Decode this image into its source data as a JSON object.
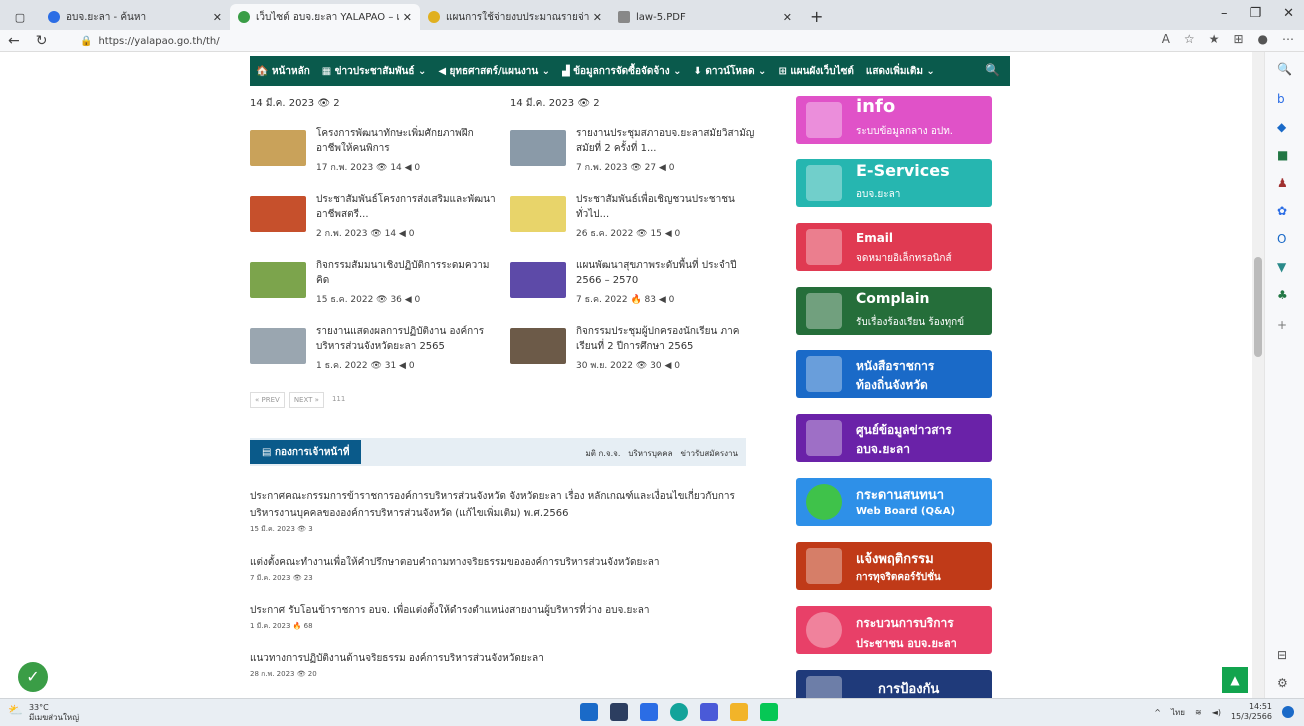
{
  "browser": {
    "tabs": [
      {
        "label": "อบจ.ยะลา - ค้นหา",
        "color": "#2b6de5"
      },
      {
        "label": "เว็บไซต์ อบจ.ยะลา YALAPAO – เว็บไ",
        "color": "#3a9d46"
      },
      {
        "label": "แผนการใช้จ่ายงบประมาณรายจ่ายประจ",
        "color": "#e0b020"
      },
      {
        "label": "law-5.PDF",
        "color": "#888888"
      }
    ],
    "new_tab": "+",
    "url": "https://yalapao.go.th/th/"
  },
  "menu": {
    "items": [
      "หน้าหลัก",
      "ข่าวประชาสัมพันธ์ ⌄",
      "ยุทธศาสตร์/แผนงาน ⌄",
      "ข้อมูลการจัดซื้อจัดจ้าง ⌄",
      "ดาวน์โหลด ⌄",
      "แผนผังเว็บไซต์",
      "แสดงเพิ่มเติม ⌄"
    ],
    "search_icon": "search-icon",
    "icon_glyphs": [
      "🏠",
      "▦",
      "◀",
      "▟",
      "⬇",
      "⊞",
      ""
    ]
  },
  "dates_top": [
    "14 มี.ค. 2023  👁 2",
    "14 มี.ค. 2023  👁 2"
  ],
  "posts": [
    {
      "title": "โครงการพัฒนาทักษะเพิ่มศักยภาพฝึกอาชีพให้คนพิการ",
      "meta": "17 ก.พ. 2023   👁 14   ◀ 0",
      "color": "#c9a25a"
    },
    {
      "title": "รายงานประชุมสภาอบจ.ยะลาสมัยวิสามัญ สมัยที่ 2 ครั้งที่ 1...",
      "meta": "7 ก.พ. 2023   👁 27   ◀ 0",
      "color": "#8a9aa8"
    },
    {
      "title": "ประชาสัมพันธ์โครงการส่งเสริมและพัฒนาอาชีพสตรี...",
      "meta": "2 ก.พ. 2023   👁 14   ◀ 0",
      "color": "#c6502c"
    },
    {
      "title": "ประชาสัมพันธ์เพื่อเชิญชวนประชาชนทั่วไป...",
      "meta": "26 ธ.ค. 2022   👁 15   ◀ 0",
      "color": "#e8d46a"
    },
    {
      "title": "กิจกรรมสัมมนาเชิงปฏิบัติการระดมความคิด",
      "meta": "15 ธ.ค. 2022   👁 36   ◀ 0",
      "color": "#7ca44c"
    },
    {
      "title": "แผนพัฒนาสุขภาพระดับพื้นที่ ประจำปี 2566 – 2570",
      "meta": "7 ธ.ค. 2022   🔥 83   ◀ 0",
      "color": "#5d4aa8"
    },
    {
      "title": "รายงานแสดงผลการปฏิบัติงาน องค์การบริหารส่วนจังหวัดยะลา 2565",
      "meta": "1 ธ.ค. 2022   👁 31   ◀ 0",
      "color": "#9aa6b0"
    },
    {
      "title": "กิจกรรมประชุมผู้ปกครองนักเรียน ภาคเรียนที่ 2 ปีการศึกษา 2565",
      "meta": "30 พ.ย. 2022   👁 30   ◀ 0",
      "color": "#6c5a48"
    }
  ],
  "pager": {
    "prev": "« PREV",
    "next": "NEXT »",
    "count": "111"
  },
  "section": {
    "title": "กองการเจ้าหน้าที่",
    "links": [
      "มติ ก.จ.จ.",
      "บริหารบุคคล",
      "ข่าวรับสมัครงาน"
    ]
  },
  "news": [
    {
      "title": "ประกาศคณะกรรมการข้าราชการองค์การบริหารส่วนจังหวัด จังหวัดยะลา เรื่อง หลักเกณฑ์และเงื่อนไขเกี่ยวกับการบริหารงานบุคคลขององค์การบริหารส่วนจังหวัด (แก้ไขเพิ่มเติม) พ.ศ.2566",
      "meta": "15 มี.ค. 2023   👁 3"
    },
    {
      "title": "แต่งตั้งคณะทำงานเพื่อให้คำปรึกษาตอบคำถามทางจริยธรรมขององค์การบริหารส่วนจังหวัดยะลา",
      "meta": "7 มี.ค. 2023   👁 23"
    },
    {
      "title": "ประกาศ รับโอนข้าราชการ อบจ. เพื่อแต่งตั้งให้ดำรงตำแหน่งสายงานผู้บริหารที่ว่าง อบจ.ยะลา",
      "meta": "1 มี.ค. 2023   🔥 68"
    },
    {
      "title": "แนวทางการปฏิบัติงานด้านจริยธรรม องค์การบริหารส่วนจังหวัดยะลา",
      "meta": "28 ก.พ. 2023   👁 20"
    }
  ],
  "banners": [
    {
      "l1": "info",
      "l2": "ระบบข้อมูลกลาง อปท.",
      "color": "#e052c8"
    },
    {
      "l1": "E-Services",
      "l2": "อบจ.ยะลา",
      "color": "#26b6b0"
    },
    {
      "l1": "Email",
      "l2": "จดหมายอิเล็กทรอนิกส์",
      "color": "#e03a52"
    },
    {
      "l1": "Complain",
      "l2": "รับเรื่องร้องเรียน ร้องทุกข์",
      "color": "#256e3a"
    },
    {
      "l1": "หนังสือราชการ",
      "l2": "ท้องถิ่นจังหวัด",
      "color": "#1a6ac8"
    },
    {
      "l1": "ศูนย์ข้อมูลข่าวสาร",
      "l2": "อบจ.ยะลา",
      "color": "#6a22a8"
    },
    {
      "l1": "กระดานสนทนา",
      "l2": "Web Board (Q&A)",
      "color": "#2e90e8"
    },
    {
      "l1": "แจ้งพฤติกรรม",
      "l2": "การทุจริตคอร์รัปชั่น",
      "color": "#c03a18"
    },
    {
      "l1": "กระบวนการบริการ",
      "l2": "ประชาชน อบจ.ยะลา",
      "color": "#e84068"
    },
    {
      "l1": "การป้องกัน",
      "l2": "",
      "color": "#1f3a7a"
    }
  ],
  "taskbar": {
    "temp": "33°C",
    "weather": "มีเมฆส่วนใหญ่",
    "time": "14:51",
    "date": "15/3/2566",
    "lang": "ไทย"
  }
}
